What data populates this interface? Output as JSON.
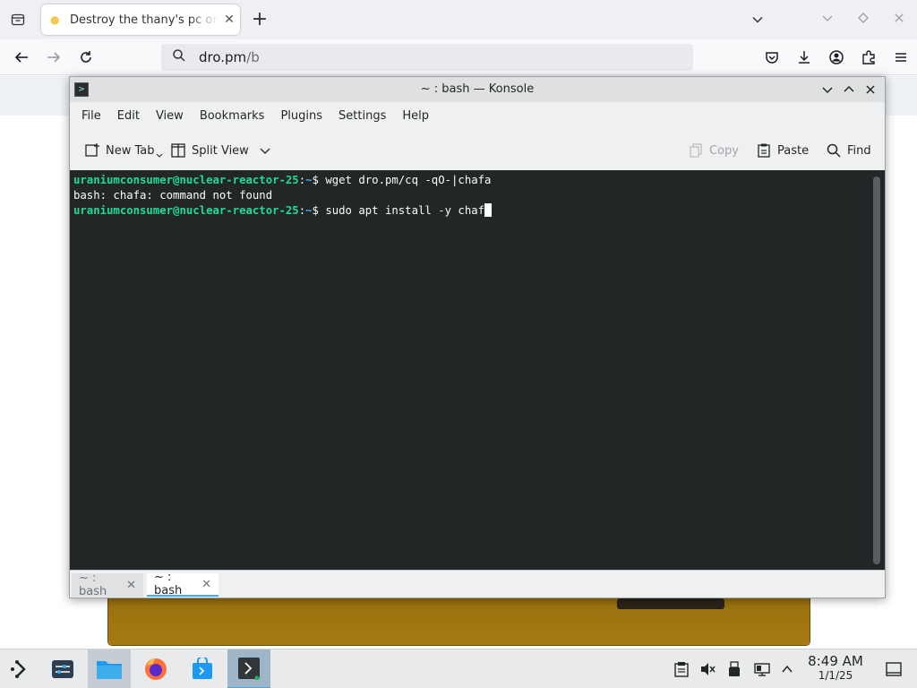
{
  "browser": {
    "tab": {
      "title": "Destroy the thany's pc on",
      "favicon": "lemon-favicon-icon",
      "close": "✕"
    },
    "url": {
      "host": "dro.pm",
      "path": "/b"
    },
    "window_controls": [
      "chevron-down-icon",
      "minimize-icon",
      "maximize-icon",
      "close-icon"
    ]
  },
  "konsole": {
    "title": "~ : bash — Konsole",
    "menu": [
      "File",
      "Edit",
      "View",
      "Bookmarks",
      "Plugins",
      "Settings",
      "Help"
    ],
    "toolbar": {
      "new_tab": "New Tab",
      "split_view": "Split View",
      "copy": "Copy",
      "paste": "Paste",
      "find": "Find"
    },
    "terminal": {
      "prompt_user": "uraniumconsumer@nuclear-reactor-25",
      "prompt_sep": ":",
      "prompt_path": "~",
      "prompt_end": "$ ",
      "line1_cmd": "wget dro.pm/cq -qO-|chafa",
      "line2_output": "bash: chafa: command not found",
      "line3_cmd": "sudo apt install -y chaf"
    },
    "tabs": [
      {
        "label": "~ : bash",
        "close": "✕",
        "active": false
      },
      {
        "label": "~ : bash",
        "close": "✕",
        "active": true
      }
    ]
  },
  "taskbar": {
    "clock": {
      "time": "8:49 AM",
      "date": "1/1/25"
    },
    "apps": [
      "application-launcher-icon",
      "system-settings-icon",
      "file-manager-icon",
      "firefox-icon",
      "discover-store-icon",
      "konsole-icon"
    ],
    "tray": [
      "clipboard-icon",
      "volume-muted-icon",
      "usb-device-icon",
      "network-wired-icon",
      "expand-tray-icon",
      "show-desktop-icon"
    ]
  },
  "colors": {
    "prompt_user": "#1cdc9a",
    "prompt_path": "#3daee9",
    "terminal_bg": "#232627",
    "accent": "#3daee9"
  }
}
